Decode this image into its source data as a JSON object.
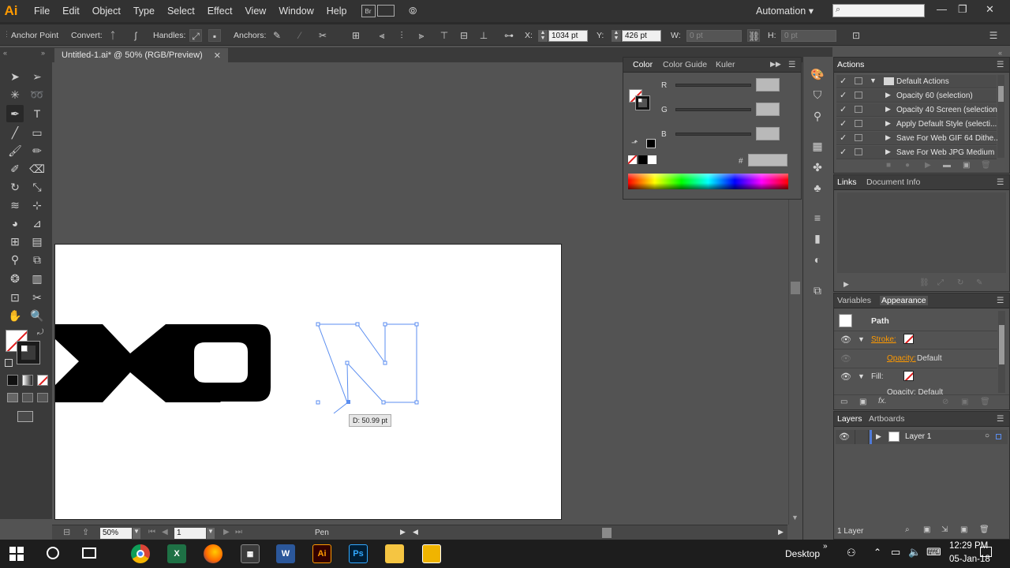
{
  "app": {
    "logo": "Ai"
  },
  "menu": [
    "File",
    "Edit",
    "Object",
    "Type",
    "Select",
    "Effect",
    "View",
    "Window",
    "Help"
  ],
  "menu_extras": {
    "bridge": "Br",
    "workspace": "Automation"
  },
  "control": {
    "anchor_point": "Anchor Point",
    "convert": "Convert:",
    "handles": "Handles:",
    "anchors": "Anchors:",
    "x_label": "X:",
    "x_value": "1034 pt",
    "y_label": "Y:",
    "y_value": "426 pt",
    "w_label": "W:",
    "w_value": "0 pt",
    "h_label": "H:",
    "h_value": "0 pt"
  },
  "doc": {
    "tab": "Untitled-1.ai* @ 50% (RGB/Preview)"
  },
  "canvas": {
    "tooltip": "D: 50.99 pt"
  },
  "status": {
    "zoom": "50%",
    "artboard": "1",
    "tool": "Pen"
  },
  "color_panel": {
    "tabs": [
      "Color",
      "Color Guide",
      "Kuler"
    ],
    "channels": [
      "R",
      "G",
      "B"
    ],
    "hash": "#"
  },
  "actions_panel": {
    "tab": "Actions",
    "items": [
      {
        "label": "Default Actions",
        "folder": true
      },
      {
        "label": "Opacity 60 (selection)"
      },
      {
        "label": "Opacity 40 Screen (selection)"
      },
      {
        "label": "Apply Default Style (selecti..."
      },
      {
        "label": "Save For Web GIF 64 Dithe..."
      },
      {
        "label": "Save For Web JPG Medium"
      }
    ]
  },
  "links_panel": {
    "tabs": [
      "Links",
      "Document Info"
    ]
  },
  "appearance_panel": {
    "tabs": [
      "Variables",
      "Appearance"
    ],
    "object": "Path",
    "stroke": "Stroke:",
    "opacity_label": "Opacity:",
    "opacity_value": "Default",
    "fill": "Fill:",
    "fill_opacity": "Opacity: Default"
  },
  "layers_panel": {
    "tabs": [
      "Layers",
      "Artboards"
    ],
    "layer": "Layer 1",
    "count": "1 Layer"
  },
  "taskbar": {
    "desktop": "Desktop",
    "time": "12:29 PM",
    "date": "05-Jan-18",
    "apps": [
      "X",
      "W",
      "Ai",
      "Ps"
    ]
  },
  "colors": {
    "accent": "#ff9a00",
    "path": "#5b8ef0",
    "ui_dark": "#323232",
    "panel": "#535353"
  }
}
